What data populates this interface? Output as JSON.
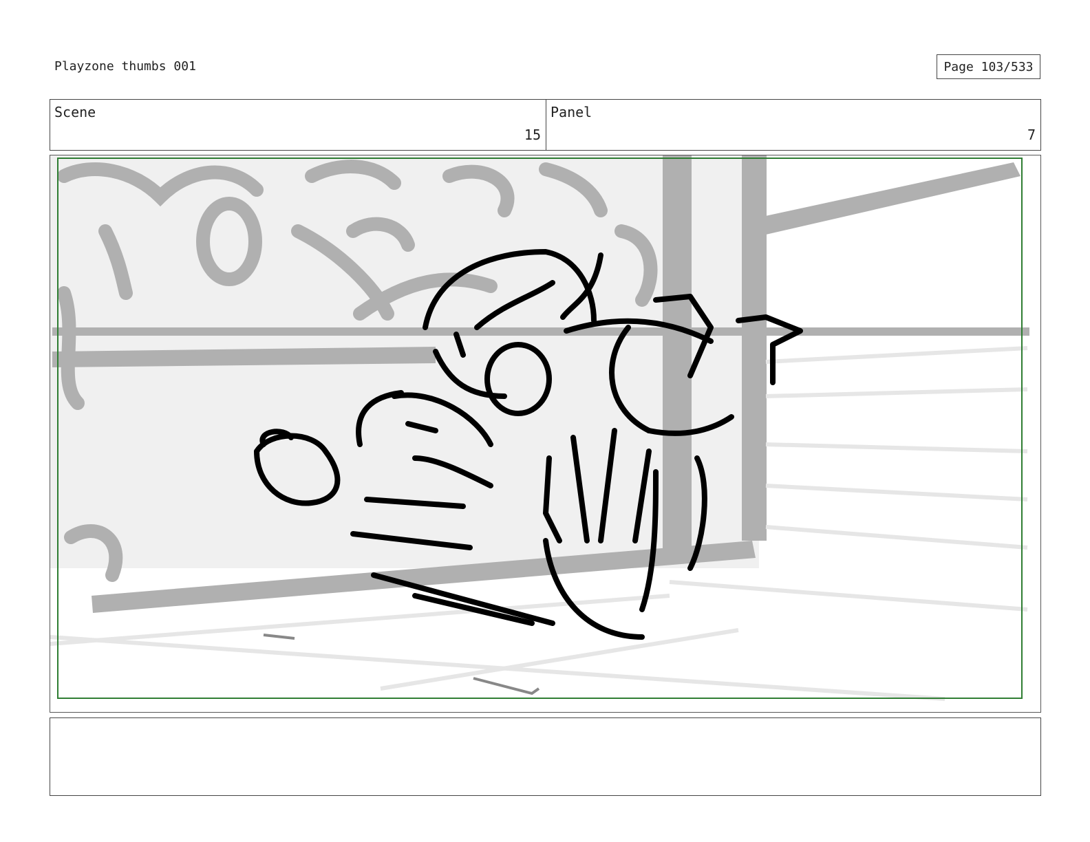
{
  "header": {
    "title": "Playzone thumbs 001",
    "page": "Page 103/533"
  },
  "scene": {
    "label": "Scene",
    "value": "15"
  },
  "panel": {
    "label": "Panel",
    "value": "7"
  },
  "drawing": {
    "subject": "storyboard-sketch",
    "colors": {
      "safe_frame": "#2e7d32",
      "background_tone": "#b0b0b0",
      "wall": "#f0f0f0",
      "ink": "#000000"
    }
  },
  "notes": {
    "text": ""
  }
}
